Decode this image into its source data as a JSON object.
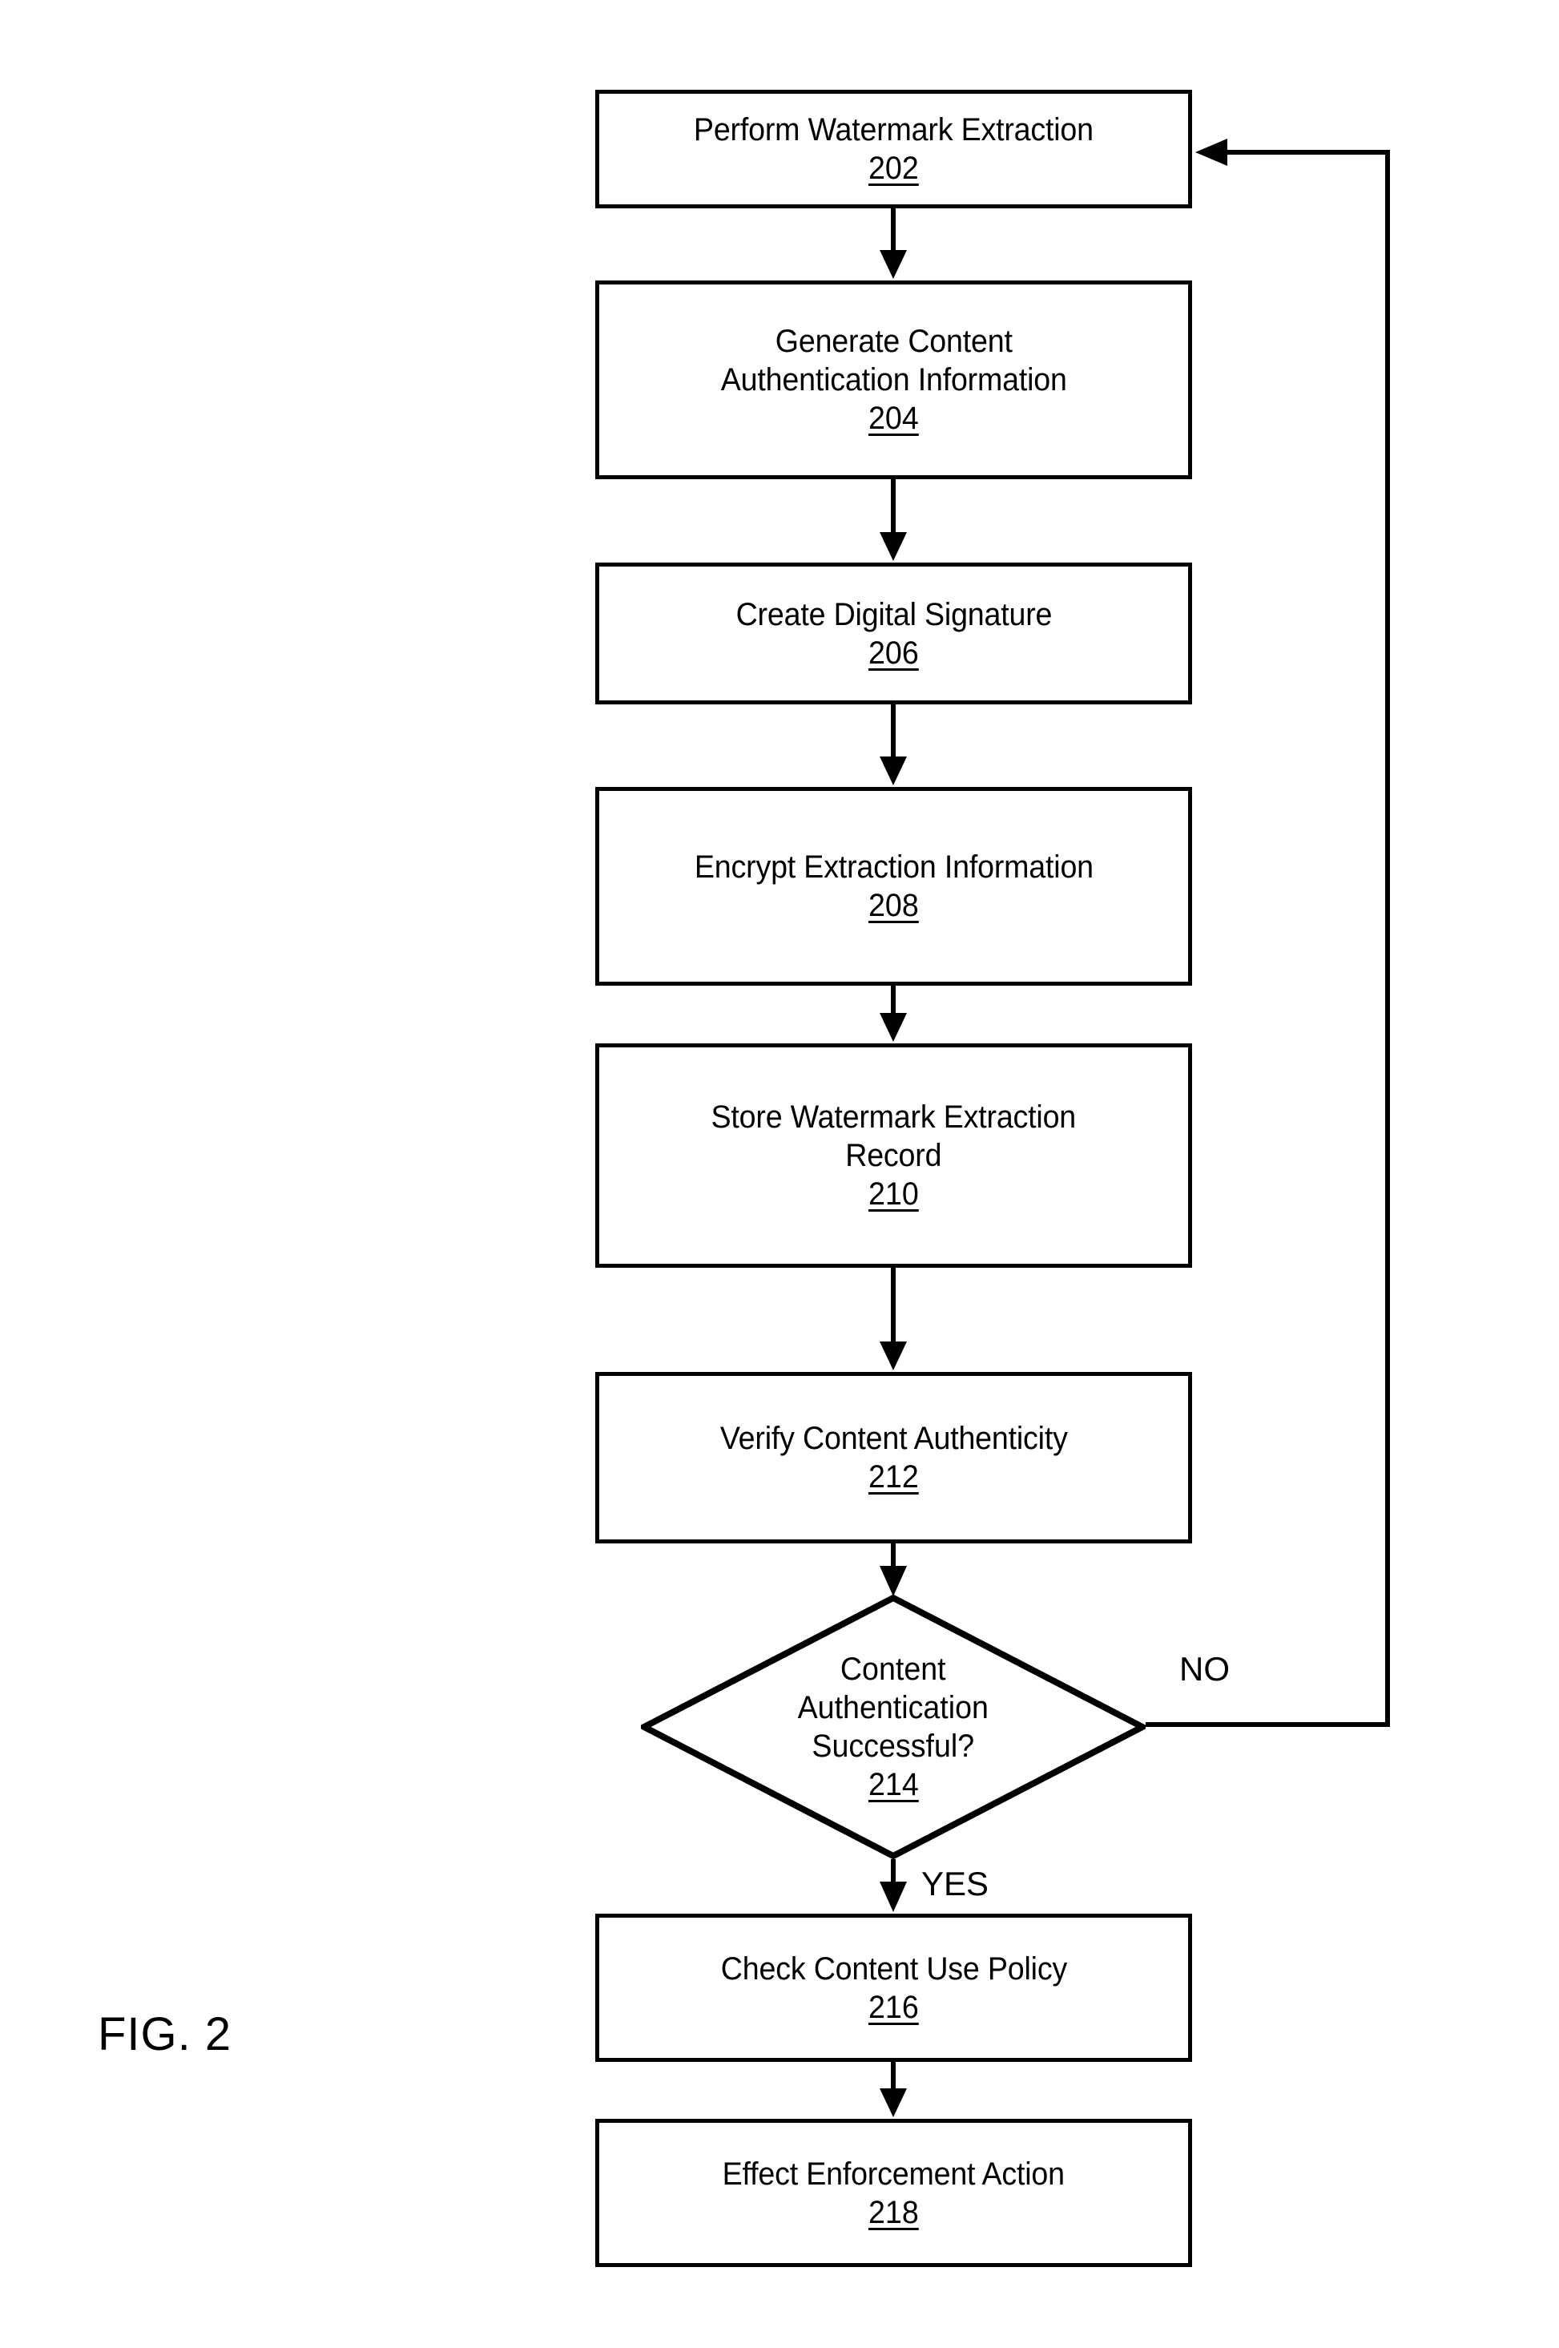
{
  "figure": {
    "caption": "FIG. 2",
    "type": "flowchart",
    "orientation": "vertical",
    "line_color": "#000000",
    "background_color": "#ffffff"
  },
  "nodes": [
    {
      "id": "202",
      "shape": "process",
      "label": "Perform Watermark Extraction",
      "ref": "202"
    },
    {
      "id": "204",
      "shape": "process",
      "label": "Generate Content\nAuthentication Information",
      "ref": "204"
    },
    {
      "id": "206",
      "shape": "process",
      "label": "Create Digital Signature",
      "ref": "206"
    },
    {
      "id": "208",
      "shape": "process",
      "label": "Encrypt Extraction Information",
      "ref": "208"
    },
    {
      "id": "210",
      "shape": "process",
      "label": "Store Watermark Extraction\nRecord",
      "ref": "210"
    },
    {
      "id": "212",
      "shape": "process",
      "label": "Verify Content Authenticity",
      "ref": "212"
    },
    {
      "id": "214",
      "shape": "decision",
      "label": "Content\nAuthentication\nSuccessful?",
      "ref": "214"
    },
    {
      "id": "216",
      "shape": "process",
      "label": "Check Content Use Policy",
      "ref": "216"
    },
    {
      "id": "218",
      "shape": "process",
      "label": "Effect Enforcement Action",
      "ref": "218"
    }
  ],
  "edges": [
    {
      "from": "202",
      "to": "204",
      "label": ""
    },
    {
      "from": "204",
      "to": "206",
      "label": ""
    },
    {
      "from": "206",
      "to": "208",
      "label": ""
    },
    {
      "from": "208",
      "to": "210",
      "label": ""
    },
    {
      "from": "210",
      "to": "212",
      "label": ""
    },
    {
      "from": "212",
      "to": "214",
      "label": ""
    },
    {
      "from": "214",
      "to": "216",
      "label": "YES"
    },
    {
      "from": "214",
      "to": "202",
      "label": "NO"
    },
    {
      "from": "216",
      "to": "218",
      "label": ""
    }
  ],
  "branch_labels": {
    "yes": "YES",
    "no": "NO"
  }
}
